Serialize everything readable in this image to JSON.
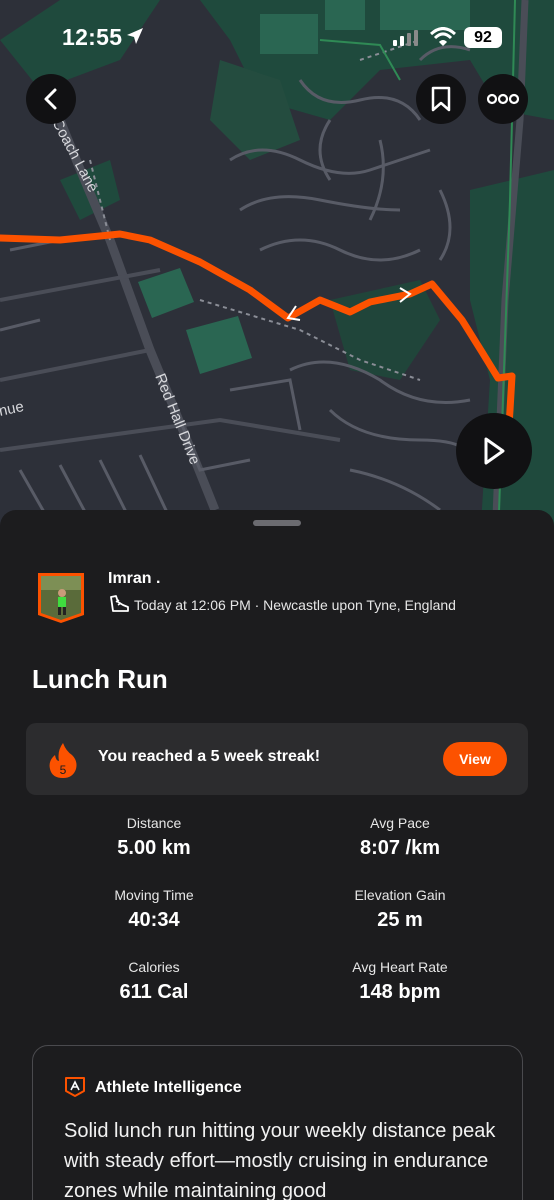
{
  "status_bar": {
    "time": "12:55",
    "battery": "92"
  },
  "map": {
    "streets": [
      "Coach Lane",
      "Red Hall Drive",
      "nue"
    ],
    "route_color": "#fc5200"
  },
  "icons": {
    "back": "chevron-left-icon",
    "bookmark": "bookmark-icon",
    "more": "more-icon",
    "play": "play-icon",
    "shoe": "shoe-icon",
    "flame": "flame-icon",
    "ai": "athlete-intelligence-icon"
  },
  "activity": {
    "athlete": "Imran .",
    "meta": "Today at 12:06 PM · Newcastle upon Tyne, England",
    "title": "Lunch Run"
  },
  "streak": {
    "count": "5",
    "text": "You reached a 5 week streak!",
    "button": "View"
  },
  "stats": [
    {
      "label": "Distance",
      "value": "5.00 km"
    },
    {
      "label": "Avg Pace",
      "value": "8:07 /km"
    },
    {
      "label": "Moving Time",
      "value": "40:34"
    },
    {
      "label": "Elevation Gain",
      "value": "25 m"
    },
    {
      "label": "Calories",
      "value": "611 Cal"
    },
    {
      "label": "Avg Heart Rate",
      "value": "148 bpm"
    }
  ],
  "athlete_intelligence": {
    "title": "Athlete Intelligence",
    "body": "Solid lunch run hitting your weekly distance peak with steady effort—mostly cruising in endurance zones while maintaining good"
  },
  "colors": {
    "accent": "#fc5200",
    "background": "#1c1c1e",
    "card": "#2c2c2e"
  }
}
